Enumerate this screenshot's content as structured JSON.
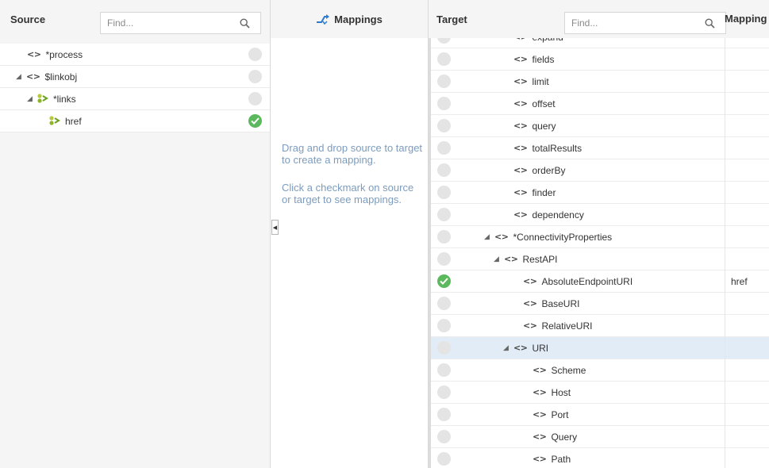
{
  "source": {
    "title": "Source",
    "find_placeholder": "Find...",
    "tree": [
      {
        "tag": "<>",
        "label": "*process",
        "depth": 1,
        "expandable": false,
        "icon": "element-tag",
        "mapped": false
      },
      {
        "tag": "<>",
        "label": "$linkobj",
        "depth": 0,
        "expandable": true,
        "icon": "element-tag",
        "mapped": false
      },
      {
        "tag": "",
        "label": "*links",
        "depth": 1,
        "expandable": true,
        "icon": "green-link-element-icon",
        "mapped": false
      },
      {
        "tag": "",
        "label": "href",
        "depth": 3,
        "expandable": false,
        "icon": "green-link-element-icon",
        "mapped": true
      }
    ]
  },
  "mappings": {
    "title": "Mappings",
    "hint_drag": "Drag and drop source to target to create a mapping.",
    "hint_click": "Click a checkmark on source or target to see mappings."
  },
  "target": {
    "title": "Target",
    "find_placeholder": "Find...",
    "mapping_column": "Mapping",
    "rows": [
      {
        "label": "expand",
        "depth": 3,
        "expandable": false,
        "mapped": false,
        "mapping": ""
      },
      {
        "label": "fields",
        "depth": 3,
        "expandable": false,
        "mapped": false,
        "mapping": ""
      },
      {
        "label": "limit",
        "depth": 3,
        "expandable": false,
        "mapped": false,
        "mapping": ""
      },
      {
        "label": "offset",
        "depth": 3,
        "expandable": false,
        "mapped": false,
        "mapping": ""
      },
      {
        "label": "query",
        "depth": 3,
        "expandable": false,
        "mapped": false,
        "mapping": ""
      },
      {
        "label": "totalResults",
        "depth": 3,
        "expandable": false,
        "mapped": false,
        "mapping": ""
      },
      {
        "label": "orderBy",
        "depth": 3,
        "expandable": false,
        "mapped": false,
        "mapping": ""
      },
      {
        "label": "finder",
        "depth": 3,
        "expandable": false,
        "mapped": false,
        "mapping": ""
      },
      {
        "label": "dependency",
        "depth": 3,
        "expandable": false,
        "mapped": false,
        "mapping": ""
      },
      {
        "label": "*ConnectivityProperties",
        "depth": 1,
        "expandable": true,
        "mapped": false,
        "mapping": ""
      },
      {
        "label": "RestAPI",
        "depth": 2,
        "expandable": true,
        "mapped": false,
        "mapping": ""
      },
      {
        "label": "AbsoluteEndpointURI",
        "depth": 4,
        "expandable": false,
        "mapped": true,
        "mapping": "href"
      },
      {
        "label": "BaseURI",
        "depth": 4,
        "expandable": false,
        "mapped": false,
        "mapping": ""
      },
      {
        "label": "RelativeURI",
        "depth": 4,
        "expandable": false,
        "mapped": false,
        "mapping": ""
      },
      {
        "label": "URI",
        "depth": 3,
        "expandable": true,
        "mapped": false,
        "mapping": "",
        "selected": true
      },
      {
        "label": "Scheme",
        "depth": 5,
        "expandable": false,
        "mapped": false,
        "mapping": ""
      },
      {
        "label": "Host",
        "depth": 5,
        "expandable": false,
        "mapped": false,
        "mapping": ""
      },
      {
        "label": "Port",
        "depth": 5,
        "expandable": false,
        "mapped": false,
        "mapping": ""
      },
      {
        "label": "Query",
        "depth": 5,
        "expandable": false,
        "mapped": false,
        "mapping": ""
      },
      {
        "label": "Path",
        "depth": 5,
        "expandable": false,
        "mapped": false,
        "mapping": ""
      }
    ],
    "element_tag": "<>"
  },
  "colors": {
    "mapped_green": "#5cb85c",
    "hint_blue": "#7c9cbf",
    "selected_row": "#e1ecf7",
    "unmapped_circle": "#e4e4e4"
  }
}
